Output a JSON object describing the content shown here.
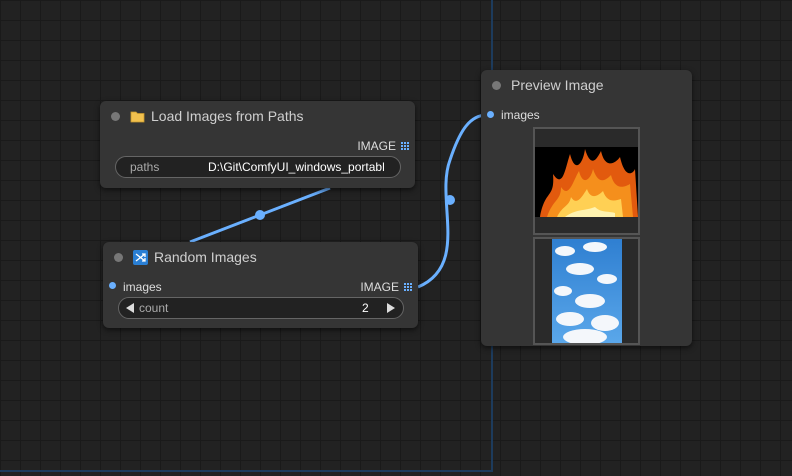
{
  "nodes": {
    "load_images": {
      "title": "Load Images from Paths",
      "output_label": "IMAGE",
      "widget_label": "paths",
      "widget_value": "D:\\Git\\ComfyUI_windows_portabl"
    },
    "random_images": {
      "title": "Random Images",
      "input_label": "images",
      "output_label": "IMAGE",
      "widget_label": "count",
      "widget_value": "2"
    },
    "preview_image": {
      "title": "Preview Image",
      "input_label": "images"
    }
  },
  "colors": {
    "link": "#6ab0ff",
    "node_bg": "#353535",
    "canvas_bg": "#222222"
  },
  "icons": [
    "folder-icon",
    "shuffle-icon",
    "grid-icon",
    "triangle-left-icon",
    "triangle-right-icon"
  ]
}
